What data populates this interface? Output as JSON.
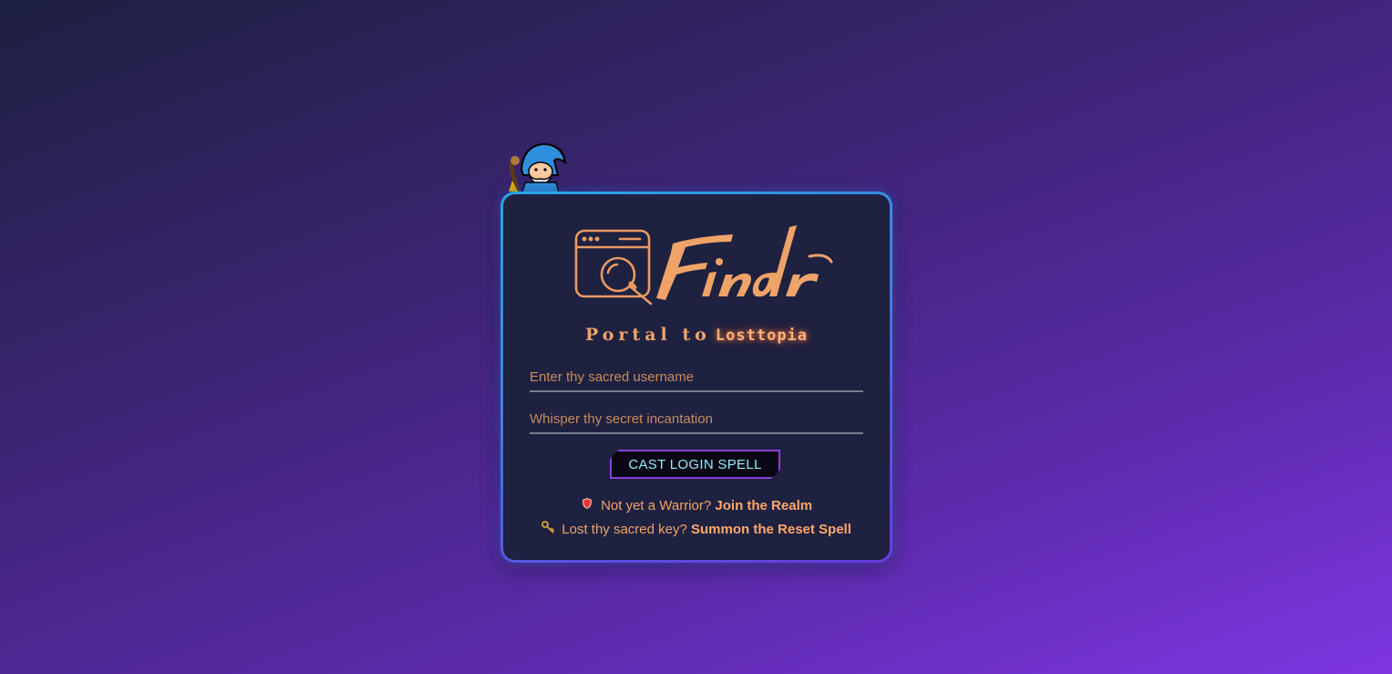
{
  "brand": {
    "logo_text": "Findr",
    "subtitle_prefix": "Portal to",
    "subtitle_realm": "Losttopia"
  },
  "login_form": {
    "username_placeholder": "Enter thy sacred username",
    "password_placeholder": "Whisper thy secret incantation",
    "submit_label": "CAST LOGIN SPELL"
  },
  "links": {
    "signup_prompt": "Not yet a Warrior?",
    "signup_link": "Join the Realm",
    "reset_prompt": "Lost thy sacred key?",
    "reset_link": "Summon the Reset Spell"
  },
  "icons": {
    "mascot": "wizard-icon",
    "signup": "shield-icon",
    "reset": "key-icon"
  },
  "colors": {
    "accent_orange": "#f0a368",
    "card_bg": "#1e2140",
    "border_blue": "#25a7e3",
    "button_text": "#8ef0ff",
    "button_border": "#8a3fd6"
  }
}
